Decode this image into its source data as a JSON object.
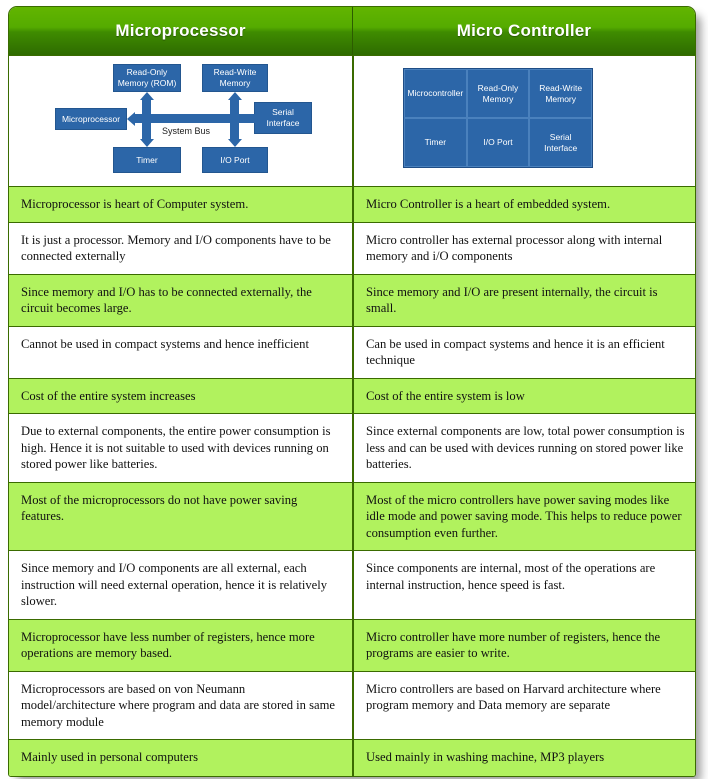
{
  "table": {
    "headers": {
      "left": "Microprocessor",
      "right": "Micro Controller"
    },
    "colors": {
      "header_gradient_top": "#62b500",
      "header_gradient_bottom": "#2e6b00",
      "row_highlight": "#B1F25E",
      "row_plain": "#ffffff",
      "diagram_blue": "#2C66A8",
      "border": "#3a6b00"
    },
    "diagrams": {
      "microprocessor": {
        "blocks": [
          "Read-Only Memory (ROM)",
          "Read-Write Memory",
          "Microprocessor",
          "Serial Interface",
          "Timer",
          "I/O Port"
        ],
        "bus_label": "System Bus"
      },
      "microcontroller": {
        "cells": [
          "Microcontroller",
          "Read-Only Memory",
          "Read-Write Memory",
          "Timer",
          "I/O Port",
          "Serial Interface"
        ]
      }
    },
    "rows": [
      {
        "highlight": true,
        "left": "Microprocessor is heart of Computer system.",
        "right": "Micro Controller is a heart of embedded system."
      },
      {
        "highlight": false,
        "left": "It is just a processor. Memory and I/O components have to be connected externally",
        "right": "Micro controller has external processor along with internal memory and i/O components"
      },
      {
        "highlight": true,
        "left": "Since memory and I/O has to be connected externally, the circuit becomes large.",
        "right": "Since memory and I/O are present internally, the circuit is small."
      },
      {
        "highlight": false,
        "left": "Cannot be used in compact systems and hence inefficient",
        "right": "Can be used in compact systems and hence it is an efficient technique"
      },
      {
        "highlight": true,
        "left": "Cost of the entire system increases",
        "right": "Cost of the entire system is low"
      },
      {
        "highlight": false,
        "left": "Due to external components, the entire power consumption is high. Hence it is not suitable to used with devices running on stored power like batteries.",
        "right": "Since external components are low, total power consumption is less and can be used with devices running on stored power like batteries."
      },
      {
        "highlight": true,
        "left": "Most of the microprocessors do not have power saving features.",
        "right": "Most of the micro controllers have power saving modes like idle mode and power saving mode. This helps to reduce power consumption even further."
      },
      {
        "highlight": false,
        "left": "Since memory and I/O components are all external, each instruction will need external operation, hence it is relatively slower.",
        "right": "Since components are internal, most of the operations are internal instruction, hence speed is fast."
      },
      {
        "highlight": true,
        "left": "Microprocessor have less number of registers, hence more operations are memory based.",
        "right": "Micro controller have more number of registers, hence the programs are easier to write."
      },
      {
        "highlight": false,
        "left": "Microprocessors are based on von Neumann model/architecture where program and data are stored in same memory module",
        "right": "Micro controllers are based on Harvard architecture where program memory and Data memory are separate"
      },
      {
        "highlight": true,
        "left": "Mainly used in personal computers",
        "right": "Used mainly in washing machine, MP3 players"
      }
    ]
  }
}
